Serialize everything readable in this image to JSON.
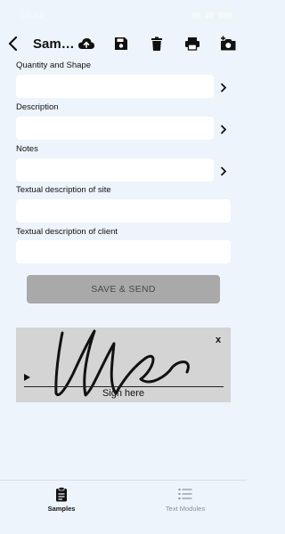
{
  "status_bar": {
    "time": "16:12"
  },
  "toolbar": {
    "title": "Sam…",
    "icons": [
      "back-icon",
      "cloud-upload-icon",
      "save-icon",
      "delete-icon",
      "print-icon",
      "add-photo-icon"
    ]
  },
  "form": {
    "fields": [
      {
        "label": "Quantity and Shape",
        "value": "",
        "chevron": true
      },
      {
        "label": "Description",
        "value": "",
        "chevron": true
      },
      {
        "label": "Notes",
        "value": "",
        "chevron": true
      },
      {
        "label": "Textual description of site",
        "value": "",
        "chevron": false
      },
      {
        "label": "Textual description of client",
        "value": "",
        "chevron": false
      }
    ],
    "save_label": "SAVE & SEND"
  },
  "signature": {
    "clear_label": "x",
    "hint": "Sign here"
  },
  "tabs": [
    {
      "label": "Samples",
      "icon": "clipboard-icon",
      "active": true,
      "color": "#111111"
    },
    {
      "label": "Text Modules",
      "icon": "list-icon",
      "active": false,
      "color": "#8a8f98"
    }
  ]
}
